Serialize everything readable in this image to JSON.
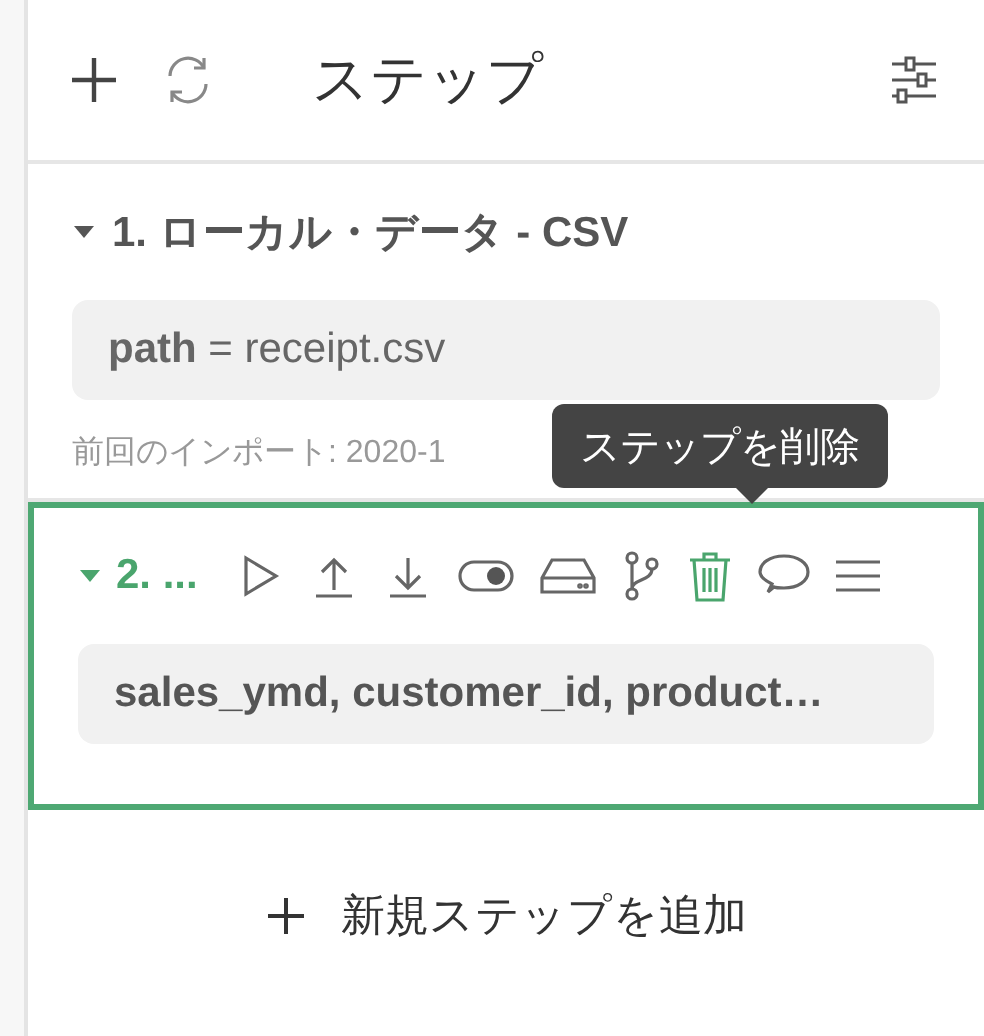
{
  "header": {
    "title": "ステップ"
  },
  "steps": [
    {
      "title": "1. ローカル・データ - CSV",
      "expanded": true,
      "selected": false,
      "params": "**path** = receipt.csv",
      "note": "前回のインポート: 2020-1"
    },
    {
      "title": "2. ...",
      "expanded": true,
      "selected": true,
      "params": "**sales_ymd**, **customer_id**, **product…**",
      "toolbar": [
        {
          "kind": "run",
          "highlighted": false
        },
        {
          "kind": "upload",
          "highlighted": false
        },
        {
          "kind": "download",
          "highlighted": false
        },
        {
          "kind": "toggle",
          "highlighted": false
        },
        {
          "kind": "drive",
          "highlighted": false
        },
        {
          "kind": "branch",
          "highlighted": false
        },
        {
          "kind": "trash",
          "highlighted": true
        },
        {
          "kind": "comment",
          "highlighted": false
        },
        {
          "kind": "menu",
          "highlighted": false
        }
      ]
    }
  ],
  "tooltip": {
    "text": "ステップを削除"
  },
  "add_button": {
    "label": "新規ステップを追加"
  }
}
